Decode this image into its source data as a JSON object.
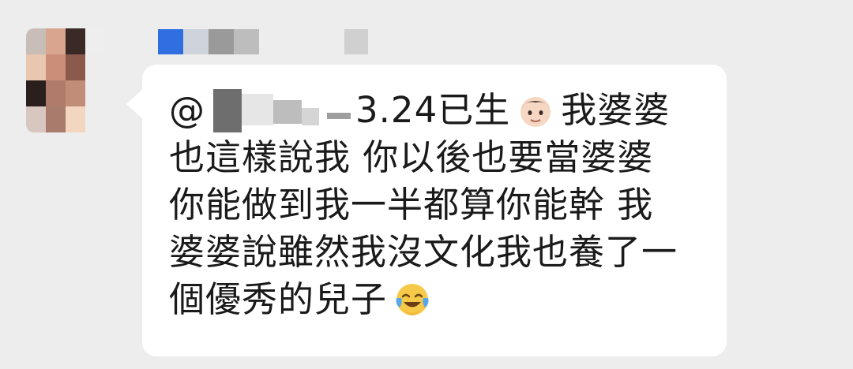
{
  "chat": {
    "message": {
      "mention_prefix": "@",
      "line1_text": "3.24已生",
      "line1_tail": "我婆婆",
      "line2": "也這樣說我  你以後也要當婆婆",
      "line3": "你能做到我一半都算你能幹  我",
      "line4": "婆婆說雖然我沒文化我也養了一",
      "line5": "個優秀的兒子",
      "emoji_1": "boy-light-skin-tone-emoji",
      "emoji_2": "face-with-tears-of-joy-emoji"
    },
    "colors": {
      "background": "#ededed",
      "bubble": "#ffffff",
      "text": "#1a1a1a",
      "name_blue_block": "#2f6fe0"
    }
  }
}
